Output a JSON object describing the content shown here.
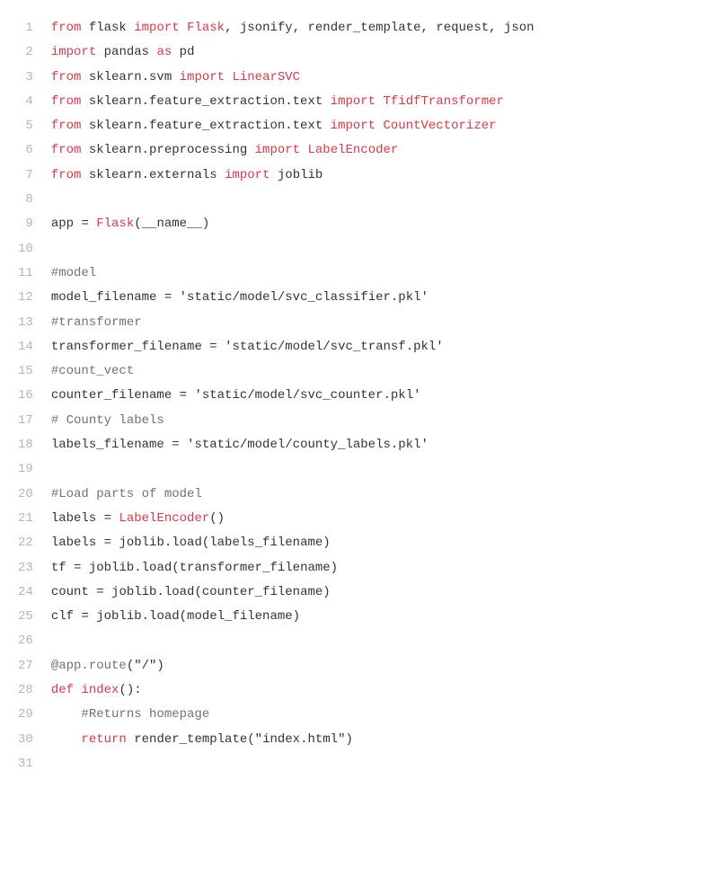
{
  "code": {
    "lines": [
      {
        "num": 1,
        "tokens": [
          {
            "t": "from",
            "c": "kw"
          },
          {
            "t": " flask "
          },
          {
            "t": "import",
            "c": "kw"
          },
          {
            "t": " "
          },
          {
            "t": "Flask",
            "c": "fn"
          },
          {
            "t": ", jsonify, render_template, request, json"
          }
        ]
      },
      {
        "num": 2,
        "tokens": [
          {
            "t": "import",
            "c": "kw"
          },
          {
            "t": " pandas "
          },
          {
            "t": "as",
            "c": "kw"
          },
          {
            "t": " pd"
          }
        ]
      },
      {
        "num": 3,
        "tokens": [
          {
            "t": "from",
            "c": "kw"
          },
          {
            "t": " sklearn.svm "
          },
          {
            "t": "import",
            "c": "kw"
          },
          {
            "t": " "
          },
          {
            "t": "LinearSVC",
            "c": "fn"
          }
        ]
      },
      {
        "num": 4,
        "tokens": [
          {
            "t": "from",
            "c": "kw"
          },
          {
            "t": " sklearn.feature_extraction.text "
          },
          {
            "t": "import",
            "c": "kw"
          },
          {
            "t": " "
          },
          {
            "t": "TfidfTransformer",
            "c": "fn"
          }
        ]
      },
      {
        "num": 5,
        "tokens": [
          {
            "t": "from",
            "c": "kw"
          },
          {
            "t": " sklearn.feature_extraction.text "
          },
          {
            "t": "import",
            "c": "kw"
          },
          {
            "t": " "
          },
          {
            "t": "CountVectorizer",
            "c": "fn"
          }
        ]
      },
      {
        "num": 6,
        "tokens": [
          {
            "t": "from",
            "c": "kw"
          },
          {
            "t": " sklearn.preprocessing "
          },
          {
            "t": "import",
            "c": "kw"
          },
          {
            "t": " "
          },
          {
            "t": "LabelEncoder",
            "c": "fn"
          }
        ]
      },
      {
        "num": 7,
        "tokens": [
          {
            "t": "from",
            "c": "kw"
          },
          {
            "t": " sklearn.externals "
          },
          {
            "t": "import",
            "c": "kw"
          },
          {
            "t": " joblib"
          }
        ]
      },
      {
        "num": 8,
        "tokens": []
      },
      {
        "num": 9,
        "tokens": [
          {
            "t": "app "
          },
          {
            "t": "="
          },
          {
            "t": " "
          },
          {
            "t": "Flask",
            "c": "fn"
          },
          {
            "t": "(__name__)"
          }
        ]
      },
      {
        "num": 10,
        "tokens": []
      },
      {
        "num": 11,
        "tokens": [
          {
            "t": "#model",
            "c": "comment"
          }
        ]
      },
      {
        "num": 12,
        "tokens": [
          {
            "t": "model_filename "
          },
          {
            "t": "="
          },
          {
            "t": " "
          },
          {
            "t": "'static/model/svc_classifier.pkl'"
          }
        ]
      },
      {
        "num": 13,
        "tokens": [
          {
            "t": "#transformer",
            "c": "comment"
          }
        ]
      },
      {
        "num": 14,
        "tokens": [
          {
            "t": "transformer_filename "
          },
          {
            "t": "="
          },
          {
            "t": " "
          },
          {
            "t": "'static/model/svc_transf.pkl'"
          }
        ]
      },
      {
        "num": 15,
        "tokens": [
          {
            "t": "#count_vect",
            "c": "comment"
          }
        ]
      },
      {
        "num": 16,
        "tokens": [
          {
            "t": "counter_filename "
          },
          {
            "t": "="
          },
          {
            "t": " "
          },
          {
            "t": "'static/model/svc_counter.pkl'"
          }
        ]
      },
      {
        "num": 17,
        "tokens": [
          {
            "t": "# County labels",
            "c": "comment"
          }
        ]
      },
      {
        "num": 18,
        "tokens": [
          {
            "t": "labels_filename "
          },
          {
            "t": "="
          },
          {
            "t": " "
          },
          {
            "t": "'static/model/county_labels.pkl'"
          }
        ]
      },
      {
        "num": 19,
        "tokens": []
      },
      {
        "num": 20,
        "tokens": [
          {
            "t": "#Load parts of model",
            "c": "comment"
          }
        ]
      },
      {
        "num": 21,
        "tokens": [
          {
            "t": "labels "
          },
          {
            "t": "="
          },
          {
            "t": " "
          },
          {
            "t": "LabelEncoder",
            "c": "fn"
          },
          {
            "t": "()"
          }
        ]
      },
      {
        "num": 22,
        "tokens": [
          {
            "t": "labels "
          },
          {
            "t": "="
          },
          {
            "t": " joblib.load(labels_filename)"
          }
        ]
      },
      {
        "num": 23,
        "tokens": [
          {
            "t": "tf "
          },
          {
            "t": "="
          },
          {
            "t": " joblib.load(transformer_filename)"
          }
        ]
      },
      {
        "num": 24,
        "tokens": [
          {
            "t": "count "
          },
          {
            "t": "="
          },
          {
            "t": " joblib.load(counter_filename)"
          }
        ]
      },
      {
        "num": 25,
        "tokens": [
          {
            "t": "clf "
          },
          {
            "t": "="
          },
          {
            "t": " joblib.load(model_filename)"
          }
        ]
      },
      {
        "num": 26,
        "tokens": []
      },
      {
        "num": 27,
        "tokens": [
          {
            "t": "@app.route",
            "c": "comment"
          },
          {
            "t": "(\"/\")"
          }
        ]
      },
      {
        "num": 28,
        "tokens": [
          {
            "t": "def",
            "c": "kw"
          },
          {
            "t": " "
          },
          {
            "t": "index",
            "c": "fn"
          },
          {
            "t": "():"
          }
        ]
      },
      {
        "num": 29,
        "tokens": [
          {
            "t": "    "
          },
          {
            "t": "#Returns homepage",
            "c": "comment"
          }
        ]
      },
      {
        "num": 30,
        "tokens": [
          {
            "t": "    "
          },
          {
            "t": "return",
            "c": "kw"
          },
          {
            "t": " render_template("
          },
          {
            "t": "\"index.html\""
          },
          {
            "t": ")"
          }
        ]
      },
      {
        "num": 31,
        "tokens": []
      }
    ]
  }
}
